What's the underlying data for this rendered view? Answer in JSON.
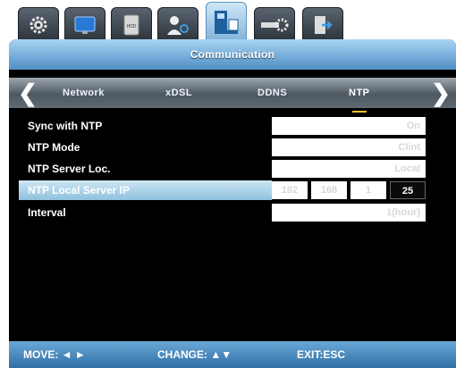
{
  "top_tabs": [
    {
      "icon": "gear-icon"
    },
    {
      "icon": "monitor-icon"
    },
    {
      "icon": "hdd-icon",
      "text": "HDD"
    },
    {
      "icon": "user-icon"
    },
    {
      "icon": "network-icon",
      "active": true
    },
    {
      "icon": "system-settings-icon"
    },
    {
      "icon": "exit-door-icon"
    }
  ],
  "title": "Communication",
  "nav": {
    "left_arrow": "❮",
    "right_arrow": "❯",
    "tabs": [
      {
        "label": "Network"
      },
      {
        "label": "xDSL"
      },
      {
        "label": "DDNS"
      },
      {
        "label": "NTP",
        "active": true
      }
    ]
  },
  "settings": [
    {
      "label": "Sync with NTP",
      "value": "On"
    },
    {
      "label": "NTP Mode",
      "value": "Clint"
    },
    {
      "label": "NTP Server Loc.",
      "value": "Local"
    },
    {
      "label": "NTP Local Server IP",
      "ip": [
        "192",
        "168",
        "1",
        "25"
      ],
      "highlight": true
    },
    {
      "label": "Interval",
      "value": "1(hour)"
    }
  ],
  "footer": {
    "move": "MOVE: ◄ ►",
    "change": "CHANGE: ▲▼",
    "exit": "EXIT:ESC"
  }
}
